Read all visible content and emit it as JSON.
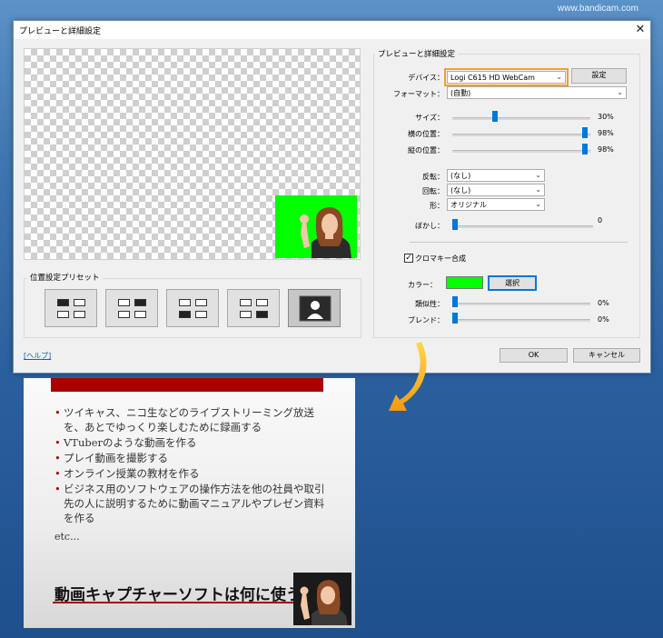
{
  "watermark": "www.bandicam.com",
  "dialog": {
    "title": "プレビューと詳細設定",
    "close_glyph": "✕",
    "preset_group_label": "位置設定プリセット",
    "settings_group_label": "プレビューと詳細設定",
    "device_label": "デバイス：",
    "device_value": "Logi C615 HD WebCam",
    "settings_button": "設定",
    "format_label": "フォーマット：",
    "format_value": "(自動)",
    "size_label": "サイズ：",
    "size_value": "30%",
    "hpos_label": "横の位置：",
    "hpos_value": "98%",
    "vpos_label": "縦の位置：",
    "vpos_value": "98%",
    "flip_label": "反転：",
    "flip_value": "(なし)",
    "rotate_label": "回転：",
    "rotate_value": "(なし)",
    "shape_label": "形：",
    "shape_value": "オリジナル",
    "blur_label": "ぼかし：",
    "blur_value": "0",
    "chromakey_label": "クロマキー合成",
    "chromakey_checked": true,
    "color_label": "カラー：",
    "color_hex": "#00ff00",
    "select_button": "選択",
    "similarity_label": "類似性：",
    "similarity_value": "0%",
    "blend_label": "ブレンド：",
    "blend_value": "0%",
    "help_link": "[ヘルプ]",
    "ok_button": "OK",
    "cancel_button": "キャンセル"
  },
  "slider_levels": {
    "size": 0.3,
    "hpos": 0.98,
    "vpos": 0.98,
    "blur": 0.0,
    "similarity": 0.0,
    "blend": 0.0
  },
  "slide": {
    "bullets": [
      "ツイキャス、ニコ生などのライブストリーミング放送を、あとでゆっくり楽しむために録画する",
      "VTuberのような動画を作る",
      "プレイ動画を撮影する",
      "オンライン授業の教材を作る",
      "ビジネス用のソフトウェアの操作方法を他の社員や取引先の人に説明するために動画マニュアルやプレゼン資料を作る"
    ],
    "etc": "etc...",
    "heading": "動画キャプチャーソフトは何に使う？"
  },
  "colors": {
    "accent_red": "#a90000",
    "chroma_green": "#00ff00",
    "highlight_orange": "#f0a030",
    "slider_blue": "#0078d7"
  }
}
